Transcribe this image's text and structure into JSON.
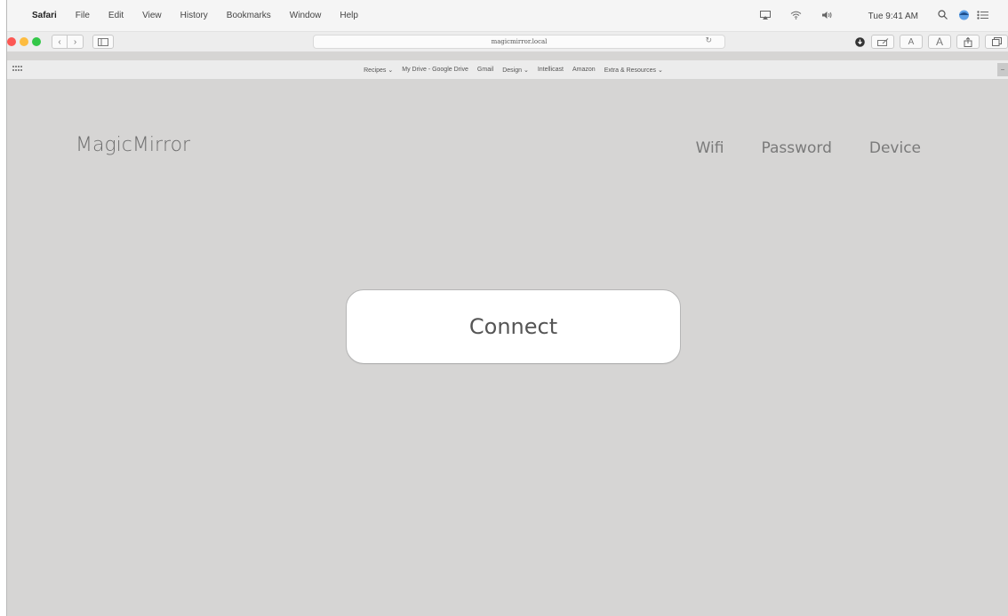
{
  "menubar": {
    "apple_icon": "apple-icon",
    "app_name": "Safari",
    "items": [
      "File",
      "Edit",
      "View",
      "History",
      "Bookmarks",
      "Window",
      "Help"
    ],
    "status_icons": [
      "airplay-icon",
      "wifi-icon",
      "volume-icon"
    ],
    "clock": "Tue 9:41 AM",
    "right_icons": [
      "search-icon",
      "siri-icon",
      "notification-center-icon"
    ]
  },
  "toolbar": {
    "back": "‹",
    "forward": "›",
    "url": "magicmirror.local",
    "reload": "↻",
    "font_small": "A",
    "font_large": "A"
  },
  "bookmarks": {
    "items": [
      "Recipes ⌄",
      "My Drive - Google Drive",
      "Gmail",
      "Design ⌄",
      "Intellicast",
      "Amazon",
      "Extra & Resources ⌄"
    ]
  },
  "page": {
    "title": "MagicMirror",
    "nav": [
      "Wifi",
      "Password",
      "Device"
    ],
    "connect_label": "Connect"
  },
  "colors": {
    "page_bg": "#d6d5d4",
    "button_bg": "#ffffff",
    "title_text": "#6e6e6e",
    "traffic_red": "#fc5753",
    "traffic_yellow": "#fdbc40",
    "traffic_green": "#33c748"
  }
}
